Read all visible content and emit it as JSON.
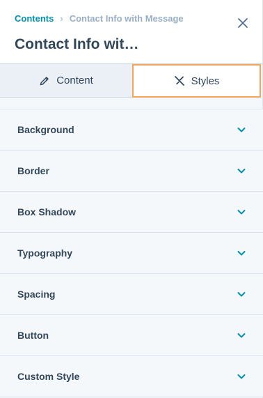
{
  "header": {
    "breadcrumb_root": "Contents",
    "breadcrumb_separator": "›",
    "breadcrumb_current": "Contact Info with Message",
    "title": "Contact Info wit…"
  },
  "tabs": [
    {
      "label": "Content",
      "icon": "pencil-icon",
      "active": false
    },
    {
      "label": "Styles",
      "icon": "brush-icon",
      "active": true
    }
  ],
  "sections": [
    {
      "label": "Background"
    },
    {
      "label": "Border"
    },
    {
      "label": "Box Shadow"
    },
    {
      "label": "Typography"
    },
    {
      "label": "Spacing"
    },
    {
      "label": "Button"
    },
    {
      "label": "Custom Style"
    }
  ],
  "colors": {
    "accent": "#0091ae",
    "active_tab_outline": "#f5a55a",
    "text": "#33475b",
    "muted": "#99afc4"
  }
}
